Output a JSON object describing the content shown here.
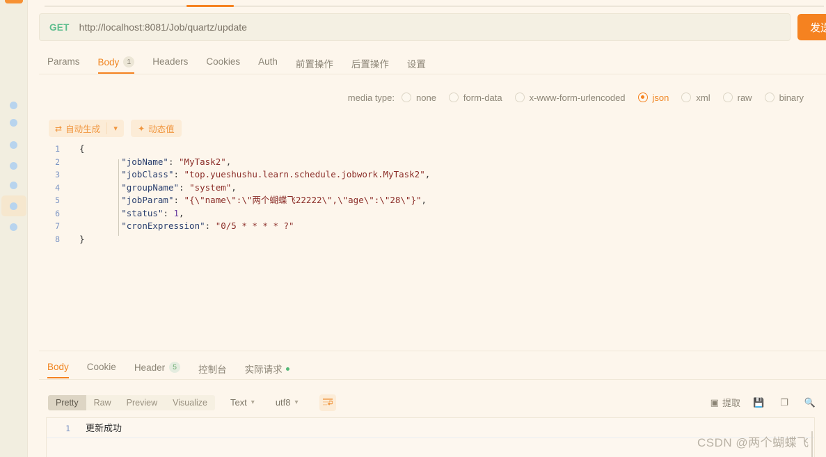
{
  "rail": {
    "dots": [
      "nav-dot-1",
      "nav-dot-2",
      "nav-dot-3",
      "nav-dot-4",
      "nav-dot-5",
      "nav-dot-6",
      "nav-dot-7"
    ],
    "selected_index": 5
  },
  "request": {
    "method": "GET",
    "url": "http://localhost:8081/Job/quartz/update",
    "send_label": "发送",
    "tabs": [
      {
        "label": "Params",
        "badge": "",
        "active": false
      },
      {
        "label": "Body",
        "badge": "1",
        "active": true
      },
      {
        "label": "Headers",
        "badge": "",
        "active": false
      },
      {
        "label": "Cookies",
        "badge": "",
        "active": false
      },
      {
        "label": "Auth",
        "badge": "",
        "active": false
      },
      {
        "label": "前置操作",
        "badge": "",
        "active": false
      },
      {
        "label": "后置操作",
        "badge": "",
        "active": false
      },
      {
        "label": "设置",
        "badge": "",
        "active": false
      }
    ]
  },
  "media_type": {
    "label": "media type:",
    "options": [
      {
        "label": "none",
        "selected": false
      },
      {
        "label": "form-data",
        "selected": false
      },
      {
        "label": "x-www-form-urlencoded",
        "selected": false
      },
      {
        "label": "json",
        "selected": true
      },
      {
        "label": "xml",
        "selected": false
      },
      {
        "label": "raw",
        "selected": false
      },
      {
        "label": "binary",
        "selected": false
      }
    ]
  },
  "body_toolbar": {
    "auto_generate_label": "自动生成",
    "auto_generate_icon": "refresh-icon",
    "caret_icon": "chevron-down-icon",
    "dynamic_value_label": "动态值",
    "dynamic_value_icon": "magic-wand-icon"
  },
  "editor": {
    "lines": [
      {
        "num": "1",
        "segments": [
          {
            "cls": "p",
            "t": "{"
          }
        ]
      },
      {
        "num": "2",
        "segments": [
          {
            "cls": "p",
            "t": "        "
          },
          {
            "cls": "k",
            "t": "\"jobName\""
          },
          {
            "cls": "p",
            "t": ": "
          },
          {
            "cls": "s",
            "t": "\"MyTask2\""
          },
          {
            "cls": "p",
            "t": ","
          }
        ]
      },
      {
        "num": "3",
        "segments": [
          {
            "cls": "p",
            "t": "        "
          },
          {
            "cls": "k",
            "t": "\"jobClass\""
          },
          {
            "cls": "p",
            "t": ": "
          },
          {
            "cls": "s",
            "t": "\"top.yueshushu.learn.schedule.jobwork.MyTask2\""
          },
          {
            "cls": "p",
            "t": ","
          }
        ]
      },
      {
        "num": "4",
        "segments": [
          {
            "cls": "p",
            "t": "        "
          },
          {
            "cls": "k",
            "t": "\"groupName\""
          },
          {
            "cls": "p",
            "t": ": "
          },
          {
            "cls": "s",
            "t": "\"system\""
          },
          {
            "cls": "p",
            "t": ","
          }
        ]
      },
      {
        "num": "5",
        "segments": [
          {
            "cls": "p",
            "t": "        "
          },
          {
            "cls": "k",
            "t": "\"jobParam\""
          },
          {
            "cls": "p",
            "t": ": "
          },
          {
            "cls": "s",
            "t": "\"{\\\"name\\\":\\\"两个蝴蝶飞22222\\\",\\\"age\\\":\\\"28\\\"}\""
          },
          {
            "cls": "p",
            "t": ","
          }
        ]
      },
      {
        "num": "6",
        "segments": [
          {
            "cls": "p",
            "t": "        "
          },
          {
            "cls": "k",
            "t": "\"status\""
          },
          {
            "cls": "p",
            "t": ": "
          },
          {
            "cls": "n",
            "t": "1"
          },
          {
            "cls": "p",
            "t": ","
          }
        ]
      },
      {
        "num": "7",
        "segments": [
          {
            "cls": "p",
            "t": "        "
          },
          {
            "cls": "k",
            "t": "\"cronExpression\""
          },
          {
            "cls": "p",
            "t": ": "
          },
          {
            "cls": "s",
            "t": "\"0/5 * * * * ?\""
          }
        ]
      },
      {
        "num": "8",
        "segments": [
          {
            "cls": "p",
            "t": "}"
          }
        ]
      }
    ]
  },
  "response": {
    "tabs": [
      {
        "label": "Body",
        "badge": "",
        "badge_kind": "",
        "dot": false,
        "active": true
      },
      {
        "label": "Cookie",
        "badge": "",
        "badge_kind": "",
        "dot": false,
        "active": false
      },
      {
        "label": "Header",
        "badge": "5",
        "badge_kind": "green",
        "dot": false,
        "active": false
      },
      {
        "label": "控制台",
        "badge": "",
        "badge_kind": "",
        "dot": false,
        "active": false
      },
      {
        "label": "实际请求",
        "badge": "",
        "badge_kind": "",
        "dot": true,
        "active": false
      }
    ],
    "format_buttons": [
      {
        "label": "Pretty",
        "active": true
      },
      {
        "label": "Raw",
        "active": false
      },
      {
        "label": "Preview",
        "active": false
      },
      {
        "label": "Visualize",
        "active": false
      }
    ],
    "type_select": "Text",
    "charset_select": "utf8",
    "wrap_icon": "word-wrap-icon",
    "right_actions": [
      {
        "icon": "extract-icon",
        "label": "提取"
      },
      {
        "icon": "save-icon",
        "label": ""
      },
      {
        "icon": "copy-icon",
        "label": ""
      },
      {
        "icon": "search-icon",
        "label": ""
      }
    ],
    "body_lines": [
      {
        "num": "1",
        "text": "更新成功"
      }
    ]
  },
  "watermark": "CSDN @两个蝴蝶飞",
  "colors": {
    "accent": "#f58220",
    "method_get": "#5cbd8d",
    "page_bg": "#fdf6ec",
    "rail_bg": "#f2eee0",
    "json_key": "#2a3f6e",
    "json_string": "#8b2d28",
    "json_number": "#6a3fa0"
  }
}
